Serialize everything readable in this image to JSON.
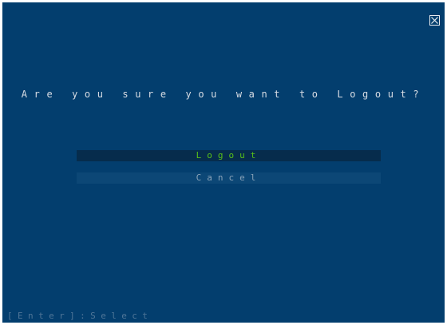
{
  "dialog": {
    "question": "Are you sure you want to Logout?",
    "options": [
      {
        "label": "Logout",
        "selected": true
      },
      {
        "label": "Cancel",
        "selected": false
      }
    ],
    "footer_hint": "[Enter]:Select",
    "close_icon": "close-x-box-icon"
  },
  "colors": {
    "background": "#033e6e",
    "selected_bg": "#062c4c",
    "selected_text": "#58c018",
    "unselected_bg": "#0c4776",
    "unselected_text": "#8aa3b9",
    "question_text": "#d8dde4",
    "hint_text": "#4f7597"
  }
}
